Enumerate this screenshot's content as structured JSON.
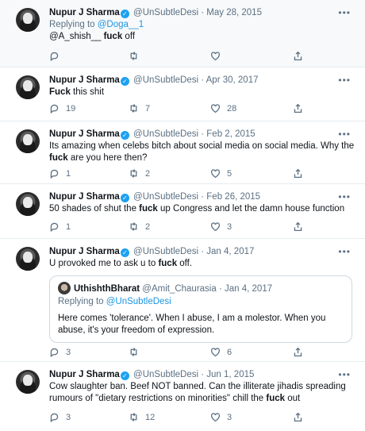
{
  "tweets": [
    {
      "name": "Nupur J Sharma",
      "handle": "@UnSubtleDesi",
      "date": "May 28, 2015",
      "reply_prefix": "Replying to ",
      "reply_to": "@Doga__1",
      "text_before": "@A_shish__ ",
      "text_bold": "fuck",
      "text_after": " off",
      "replies": "",
      "retweets": "",
      "likes": ""
    },
    {
      "name": "Nupur J Sharma",
      "handle": "@UnSubtleDesi",
      "date": "Apr 30, 2017",
      "text_before": "",
      "text_bold": "Fuck",
      "text_after": " this shit",
      "replies": "19",
      "retweets": "7",
      "likes": "28"
    },
    {
      "name": "Nupur J Sharma",
      "handle": "@UnSubtleDesi",
      "date": "Feb 2, 2015",
      "text_before": "Its amazing when celebs bitch about social media on social media. Why the ",
      "text_bold": "fuck",
      "text_after": " are you here then?",
      "replies": "1",
      "retweets": "2",
      "likes": "5"
    },
    {
      "name": "Nupur J Sharma",
      "handle": "@UnSubtleDesi",
      "date": "Feb 26, 2015",
      "text_before": "50 shades of shut the ",
      "text_bold": "fuck",
      "text_after": " up Congress and let the damn house function",
      "replies": "1",
      "retweets": "2",
      "likes": "3"
    },
    {
      "name": "Nupur J Sharma",
      "handle": "@UnSubtleDesi",
      "date": "Jan 4, 2017",
      "text_before": "U provoked me to ask u to ",
      "text_bold": "fuck",
      "text_after": " off.",
      "quote": {
        "name": "UthishthBharat",
        "handle": "@Amit_Chaurasia",
        "date": "Jan 4, 2017",
        "reply_prefix": "Replying to ",
        "reply_to": "@UnSubtleDesi",
        "text": "Here comes 'tolerance'. When I abuse, I am a molestor. When you abuse, it's your freedom of expression."
      },
      "replies": "3",
      "retweets": "",
      "likes": "6"
    },
    {
      "name": "Nupur J Sharma",
      "handle": "@UnSubtleDesi",
      "date": "Jun 1, 2015",
      "text_before": "Cow slaughter ban. Beef NOT banned. Can the illiterate jihadis spreading rumours of \"dietary restrictions on minorities\" chill the ",
      "text_bold": "fuck",
      "text_after": " out",
      "replies": "3",
      "retweets": "12",
      "likes": "3"
    }
  ],
  "ui": {
    "dot": "·",
    "more": "•••",
    "verified_glyph": "✓",
    "verified_color": "#1da1f2",
    "icons": [
      "reply-icon",
      "retweet-icon",
      "like-icon",
      "share-icon"
    ]
  }
}
